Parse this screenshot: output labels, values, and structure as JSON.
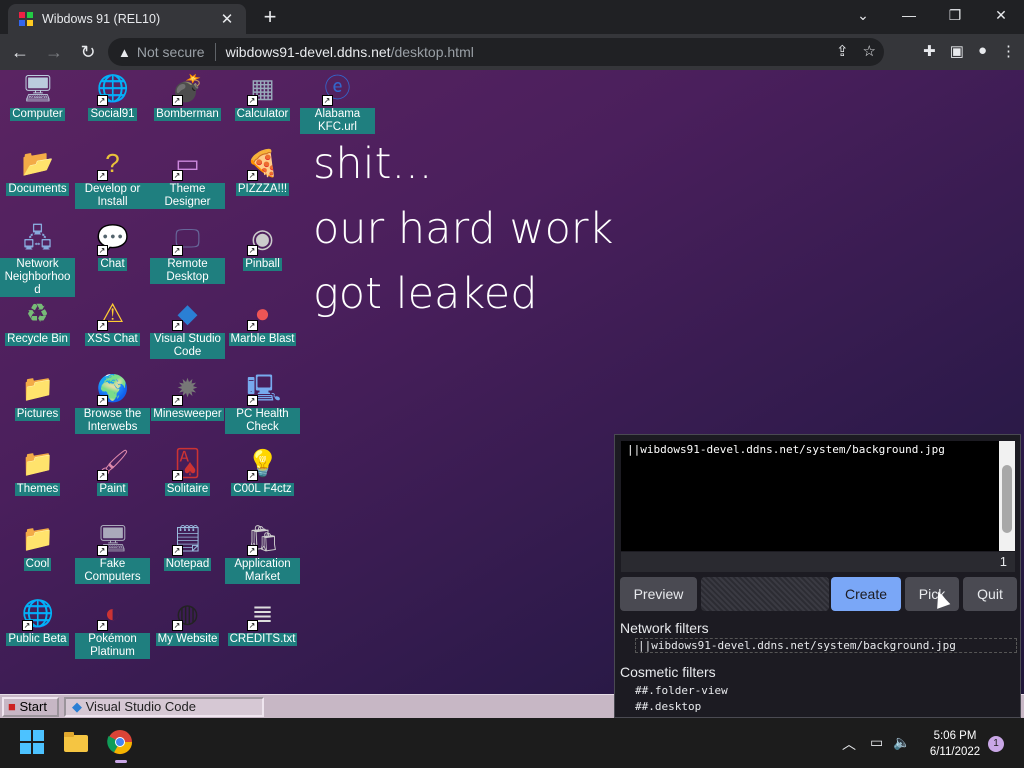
{
  "browser": {
    "tab_title": "Wibdows 91 (REL10)",
    "not_secure": "Not secure",
    "url_host": "wibdows91-devel.ddns.net",
    "url_path": "/desktop.html"
  },
  "wallpaper": {
    "lines": [
      "shit...",
      "our hard work",
      "got leaked"
    ]
  },
  "icons": [
    {
      "label": "Computer",
      "icon": "computer-icon",
      "shortcut": false
    },
    {
      "label": "Social91",
      "icon": "globe-icon",
      "shortcut": true
    },
    {
      "label": "Bomberman",
      "icon": "bomberman-icon",
      "shortcut": true
    },
    {
      "label": "Calculator",
      "icon": "calculator-icon",
      "shortcut": true
    },
    {
      "label": "Alabama KFC.url",
      "icon": "ie-icon",
      "shortcut": true
    },
    {
      "label": "Documents",
      "icon": "folder-open-icon",
      "shortcut": false
    },
    {
      "label": "Develop or Install",
      "icon": "help-icon",
      "shortcut": true
    },
    {
      "label": "Theme Designer",
      "icon": "window-icon",
      "shortcut": true
    },
    {
      "label": "PIZZZA!!!",
      "icon": "pizza-icon",
      "shortcut": true
    },
    {
      "label": "Network Neighborhood",
      "icon": "network-icon",
      "shortcut": false
    },
    {
      "label": "Chat",
      "icon": "chat-icon",
      "shortcut": true
    },
    {
      "label": "Remote Desktop",
      "icon": "remote-desktop-icon",
      "shortcut": true
    },
    {
      "label": "Pinball",
      "icon": "pinball-icon",
      "shortcut": true
    },
    {
      "label": "Recycle Bin",
      "icon": "recycle-bin-icon",
      "shortcut": false
    },
    {
      "label": "XSS Chat",
      "icon": "xss-chat-icon",
      "shortcut": true
    },
    {
      "label": "Visual Studio Code",
      "icon": "vscode-icon",
      "shortcut": true
    },
    {
      "label": "Marble Blast",
      "icon": "marble-icon",
      "shortcut": true
    },
    {
      "label": "Pictures",
      "icon": "folder-icon",
      "shortcut": false
    },
    {
      "label": "Browse the Interwebs",
      "icon": "ie-globe-icon",
      "shortcut": true
    },
    {
      "label": "Minesweeper",
      "icon": "mine-icon",
      "shortcut": true
    },
    {
      "label": "PC Health Check",
      "icon": "pc-health-icon",
      "shortcut": true
    },
    {
      "label": "Themes",
      "icon": "folder-icon",
      "shortcut": false
    },
    {
      "label": "Paint",
      "icon": "paint-icon",
      "shortcut": true
    },
    {
      "label": "Solitaire",
      "icon": "solitaire-icon",
      "shortcut": true
    },
    {
      "label": "C00L F4ctz",
      "icon": "lightbulb-icon",
      "shortcut": true
    },
    {
      "label": "Cool",
      "icon": "folder-icon",
      "shortcut": false
    },
    {
      "label": "Fake Computers",
      "icon": "fake-computer-icon",
      "shortcut": true
    },
    {
      "label": "Notepad",
      "icon": "notepad-icon",
      "shortcut": true
    },
    {
      "label": "Application Market",
      "icon": "market-icon",
      "shortcut": true
    },
    {
      "label": "Public Beta",
      "icon": "globe-icon",
      "shortcut": true
    },
    {
      "label": "Pokémon Platinum",
      "icon": "pokemon-icon",
      "shortcut": true
    },
    {
      "label": "My Website",
      "icon": "github-icon",
      "shortcut": true
    },
    {
      "label": "CREDITS.txt",
      "icon": "text-file-icon",
      "shortcut": true
    }
  ],
  "taskbar91": {
    "start": "Start",
    "task": "Visual Studio Code"
  },
  "blocker": {
    "filter_text": "||wibdows91-devel.ddns.net/system/background.jpg",
    "count": "1",
    "buttons": {
      "preview": "Preview",
      "create": "Create",
      "pick": "Pick",
      "quit": "Quit"
    },
    "network_heading": "Network filters",
    "network_filters": [
      "||wibdows91-devel.ddns.net/system/background.jpg"
    ],
    "cosmetic_heading": "Cosmetic filters",
    "cosmetic_filters": [
      "##.folder-view",
      "##.desktop"
    ]
  },
  "windows_taskbar": {
    "time": "5:06 PM",
    "date": "6/11/2022",
    "notifications": "1"
  },
  "colors": {
    "icon_label_bg": "#1f7f7f",
    "create_button": "#7aa7f7"
  }
}
